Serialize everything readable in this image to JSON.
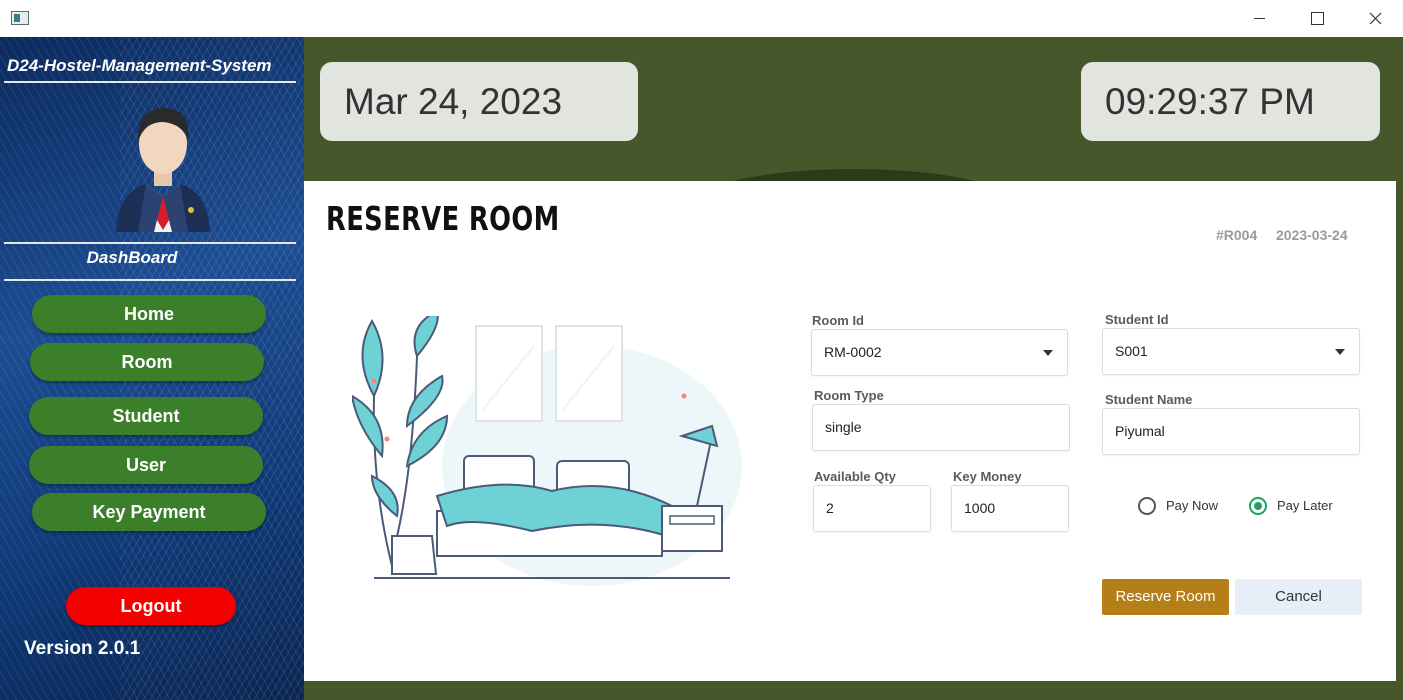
{
  "window": {
    "minimize_icon": "minimize-icon",
    "maximize_icon": "maximize-icon",
    "close_icon": "close-icon"
  },
  "sidebar": {
    "system_title": "D24-Hostel-Management-System",
    "dashboard_title": "DashBoard",
    "nav": [
      {
        "label": "Home"
      },
      {
        "label": "Room"
      },
      {
        "label": "Student"
      },
      {
        "label": "User"
      },
      {
        "label": "Key Payment"
      }
    ],
    "logout_label": "Logout",
    "version": "Version 2.0.1"
  },
  "header": {
    "date": "Mar 24, 2023",
    "time": "09:29:37 PM"
  },
  "reserve": {
    "title": "RESERVE ROOM",
    "reservation_id": "#R004",
    "reservation_date": "2023-03-24",
    "room_id": {
      "label": "Room Id",
      "value": "RM-0002"
    },
    "room_type": {
      "label": "Room Type",
      "value": "single"
    },
    "available_qty": {
      "label": "Available Qty",
      "value": "2"
    },
    "key_money": {
      "label": "Key Money",
      "value": "1000"
    },
    "student_id": {
      "label": "Student Id",
      "value": "S001"
    },
    "student_name": {
      "label": "Student Name",
      "value": "Piyumal"
    },
    "payment_options": [
      {
        "label": "Pay Now",
        "selected": false
      },
      {
        "label": "Pay Later",
        "selected": true
      }
    ],
    "reserve_button": "Reserve Room",
    "cancel_button": "Cancel"
  },
  "colors": {
    "sidebar_nav": "#3c7f2a",
    "logout": "#f40000",
    "header_bg": "#47572c",
    "reserve_button": "#b47f16",
    "radio_selected": "#22a060"
  }
}
